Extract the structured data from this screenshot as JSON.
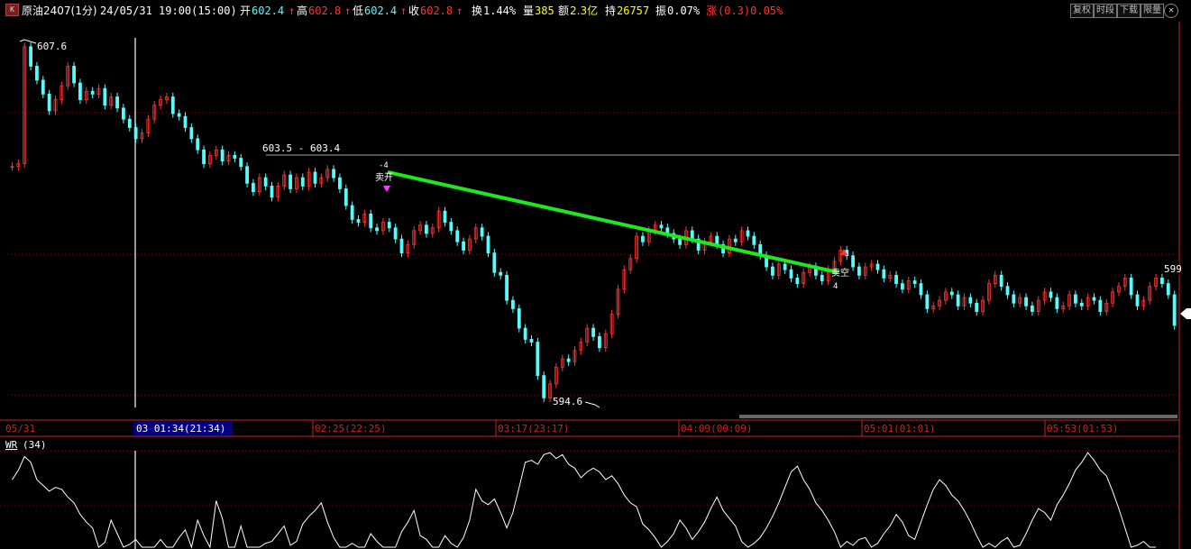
{
  "header": {
    "symbol": "原油2407(1分)",
    "datetime": "24/05/31 19:00(15:00)",
    "open_label": "开",
    "open": "602.4",
    "high_label": "高",
    "high": "602.8",
    "low_label": "低",
    "low": "602.4",
    "close_label": "收",
    "close": "602.8",
    "turnover_label": "换",
    "turnover": "1.44%",
    "volume_label": "量",
    "volume": "385",
    "amount_label": "额",
    "amount": "2.3亿",
    "hold_label": "持",
    "hold": "26757",
    "amplitude_label": "振",
    "amplitude": "0.07%",
    "change_label": "涨",
    "change": "(0.3)0.05%",
    "buttons": [
      "复权",
      "时段",
      "下载",
      "限量"
    ],
    "k_icon": "K",
    "close_icon": "close-circle-icon"
  },
  "colors": {
    "up": "#ff3232",
    "down": "#54fcfc",
    "bg": "#000000",
    "trendline": "#1ee81e",
    "grid": "#8b0000",
    "axis": "#cc2222",
    "label_bg": "#000080",
    "white": "#ffffff"
  },
  "chart_data": [
    {
      "type": "candlestick",
      "title": "原油2407(1分)",
      "ylim": [
        594.2,
        608.4
      ],
      "high_annotation": "607.6",
      "low_annotation": "594.6",
      "range_annotation": "603.5 - 603.4",
      "right_price_label": "599",
      "trendline": {
        "from": [
          "03 01:58",
          603.0
        ],
        "to": [
          "04 00:57",
          599.4
        ]
      },
      "signals": [
        {
          "time": "03 01:58",
          "top": "-4",
          "text": "卖开"
        },
        {
          "time": "04 00:57",
          "text": "卖空",
          "bottom": "4"
        }
      ],
      "x_axis_labels": [
        "05/31",
        "03 01:34(21:34)",
        "02:25(22:25)",
        "03:17(23:17)",
        "04:09(00:09)",
        "05:01(01:01)",
        "05:53(01:53)"
      ],
      "closes": [
        603.2,
        603.3,
        607.5,
        606.8,
        606.3,
        605.8,
        605.2,
        605.6,
        606.1,
        606.8,
        606.2,
        605.6,
        605.9,
        605.8,
        606.0,
        605.4,
        605.7,
        605.3,
        604.9,
        604.6,
        604.2,
        604.4,
        604.9,
        605.4,
        605.6,
        605.7,
        605.1,
        605.0,
        604.6,
        604.2,
        603.8,
        603.3,
        603.6,
        603.8,
        603.4,
        603.6,
        603.5,
        603.2,
        602.6,
        602.3,
        602.8,
        602.5,
        602.1,
        602.5,
        602.9,
        602.4,
        602.8,
        602.5,
        603.0,
        602.6,
        602.8,
        603.1,
        602.8,
        602.4,
        601.8,
        601.3,
        601.2,
        601.5,
        601.0,
        600.9,
        601.2,
        601.0,
        600.6,
        600.1,
        600.4,
        600.9,
        601.1,
        600.8,
        601.0,
        601.6,
        601.2,
        600.9,
        600.5,
        600.2,
        600.6,
        601.0,
        600.7,
        600.1,
        599.4,
        599.3,
        598.4,
        598.1,
        597.4,
        597.0,
        596.9,
        595.7,
        594.9,
        595.4,
        596.0,
        596.3,
        596.2,
        596.6,
        596.9,
        597.4,
        597.1,
        596.7,
        597.2,
        597.9,
        598.8,
        599.5,
        599.9,
        600.7,
        600.5,
        600.9,
        601.1,
        601.0,
        600.8,
        600.6,
        600.4,
        600.9,
        600.6,
        600.2,
        600.5,
        600.7,
        600.4,
        600.1,
        600.6,
        600.5,
        600.9,
        600.7,
        600.4,
        600.0,
        599.6,
        599.3,
        599.7,
        599.5,
        599.2,
        599.0,
        599.4,
        599.6,
        599.3,
        599.1,
        599.5,
        599.8,
        600.2,
        600.0,
        599.6,
        599.3,
        599.6,
        599.7,
        599.5,
        599.2,
        599.3,
        599.0,
        598.8,
        599.1,
        599.0,
        598.6,
        598.1,
        598.2,
        598.4,
        598.7,
        598.6,
        598.2,
        598.5,
        598.3,
        598.0,
        598.4,
        599.0,
        599.3,
        598.9,
        598.6,
        598.3,
        598.5,
        598.2,
        598.0,
        598.4,
        598.7,
        598.5,
        598.1,
        598.2,
        598.6,
        598.3,
        598.2,
        598.5,
        598.4,
        598.0,
        598.3,
        598.7,
        598.9,
        599.2,
        598.6,
        598.2,
        598.4,
        598.9,
        599.2,
        599.0,
        598.6,
        597.5
      ],
      "wr_panel": {
        "title": "WR",
        "param": "(34)",
        "values": [
          70,
          80,
          94,
          88,
          70,
          64,
          58,
          62,
          60,
          52,
          46,
          34,
          26,
          20,
          0,
          5,
          28,
          14,
          0,
          3,
          8,
          0,
          0,
          0,
          8,
          0,
          0,
          10,
          18,
          0,
          28,
          12,
          0,
          48,
          30,
          0,
          0,
          22,
          0,
          0,
          0,
          4,
          6,
          14,
          22,
          2,
          6,
          24,
          32,
          38,
          46,
          26,
          10,
          0,
          0,
          4,
          0,
          0,
          14,
          6,
          0,
          0,
          0,
          16,
          26,
          38,
          12,
          8,
          0,
          0,
          12,
          4,
          0,
          10,
          28,
          60,
          48,
          44,
          50,
          36,
          20,
          36,
          62,
          88,
          90,
          86,
          96,
          98,
          92,
          96,
          86,
          82,
          72,
          78,
          82,
          78,
          70,
          74,
          66,
          54,
          46,
          42,
          24,
          18,
          10,
          0,
          6,
          14,
          28,
          20,
          8,
          16,
          26,
          40,
          52,
          38,
          30,
          22,
          6,
          0,
          4,
          10,
          20,
          32,
          46,
          62,
          78,
          84,
          70,
          60,
          46,
          38,
          28,
          16,
          0,
          6,
          2,
          8,
          10,
          0,
          4,
          14,
          22,
          34,
          26,
          12,
          8,
          26,
          44,
          60,
          70,
          64,
          54,
          48,
          38,
          26,
          12,
          0,
          4,
          0,
          6,
          10,
          0,
          2,
          14,
          28,
          40,
          36,
          28,
          44,
          54,
          66,
          80,
          88,
          98,
          90,
          80,
          74,
          58,
          40,
          20,
          0,
          2,
          6,
          0,
          0
        ]
      }
    }
  ]
}
